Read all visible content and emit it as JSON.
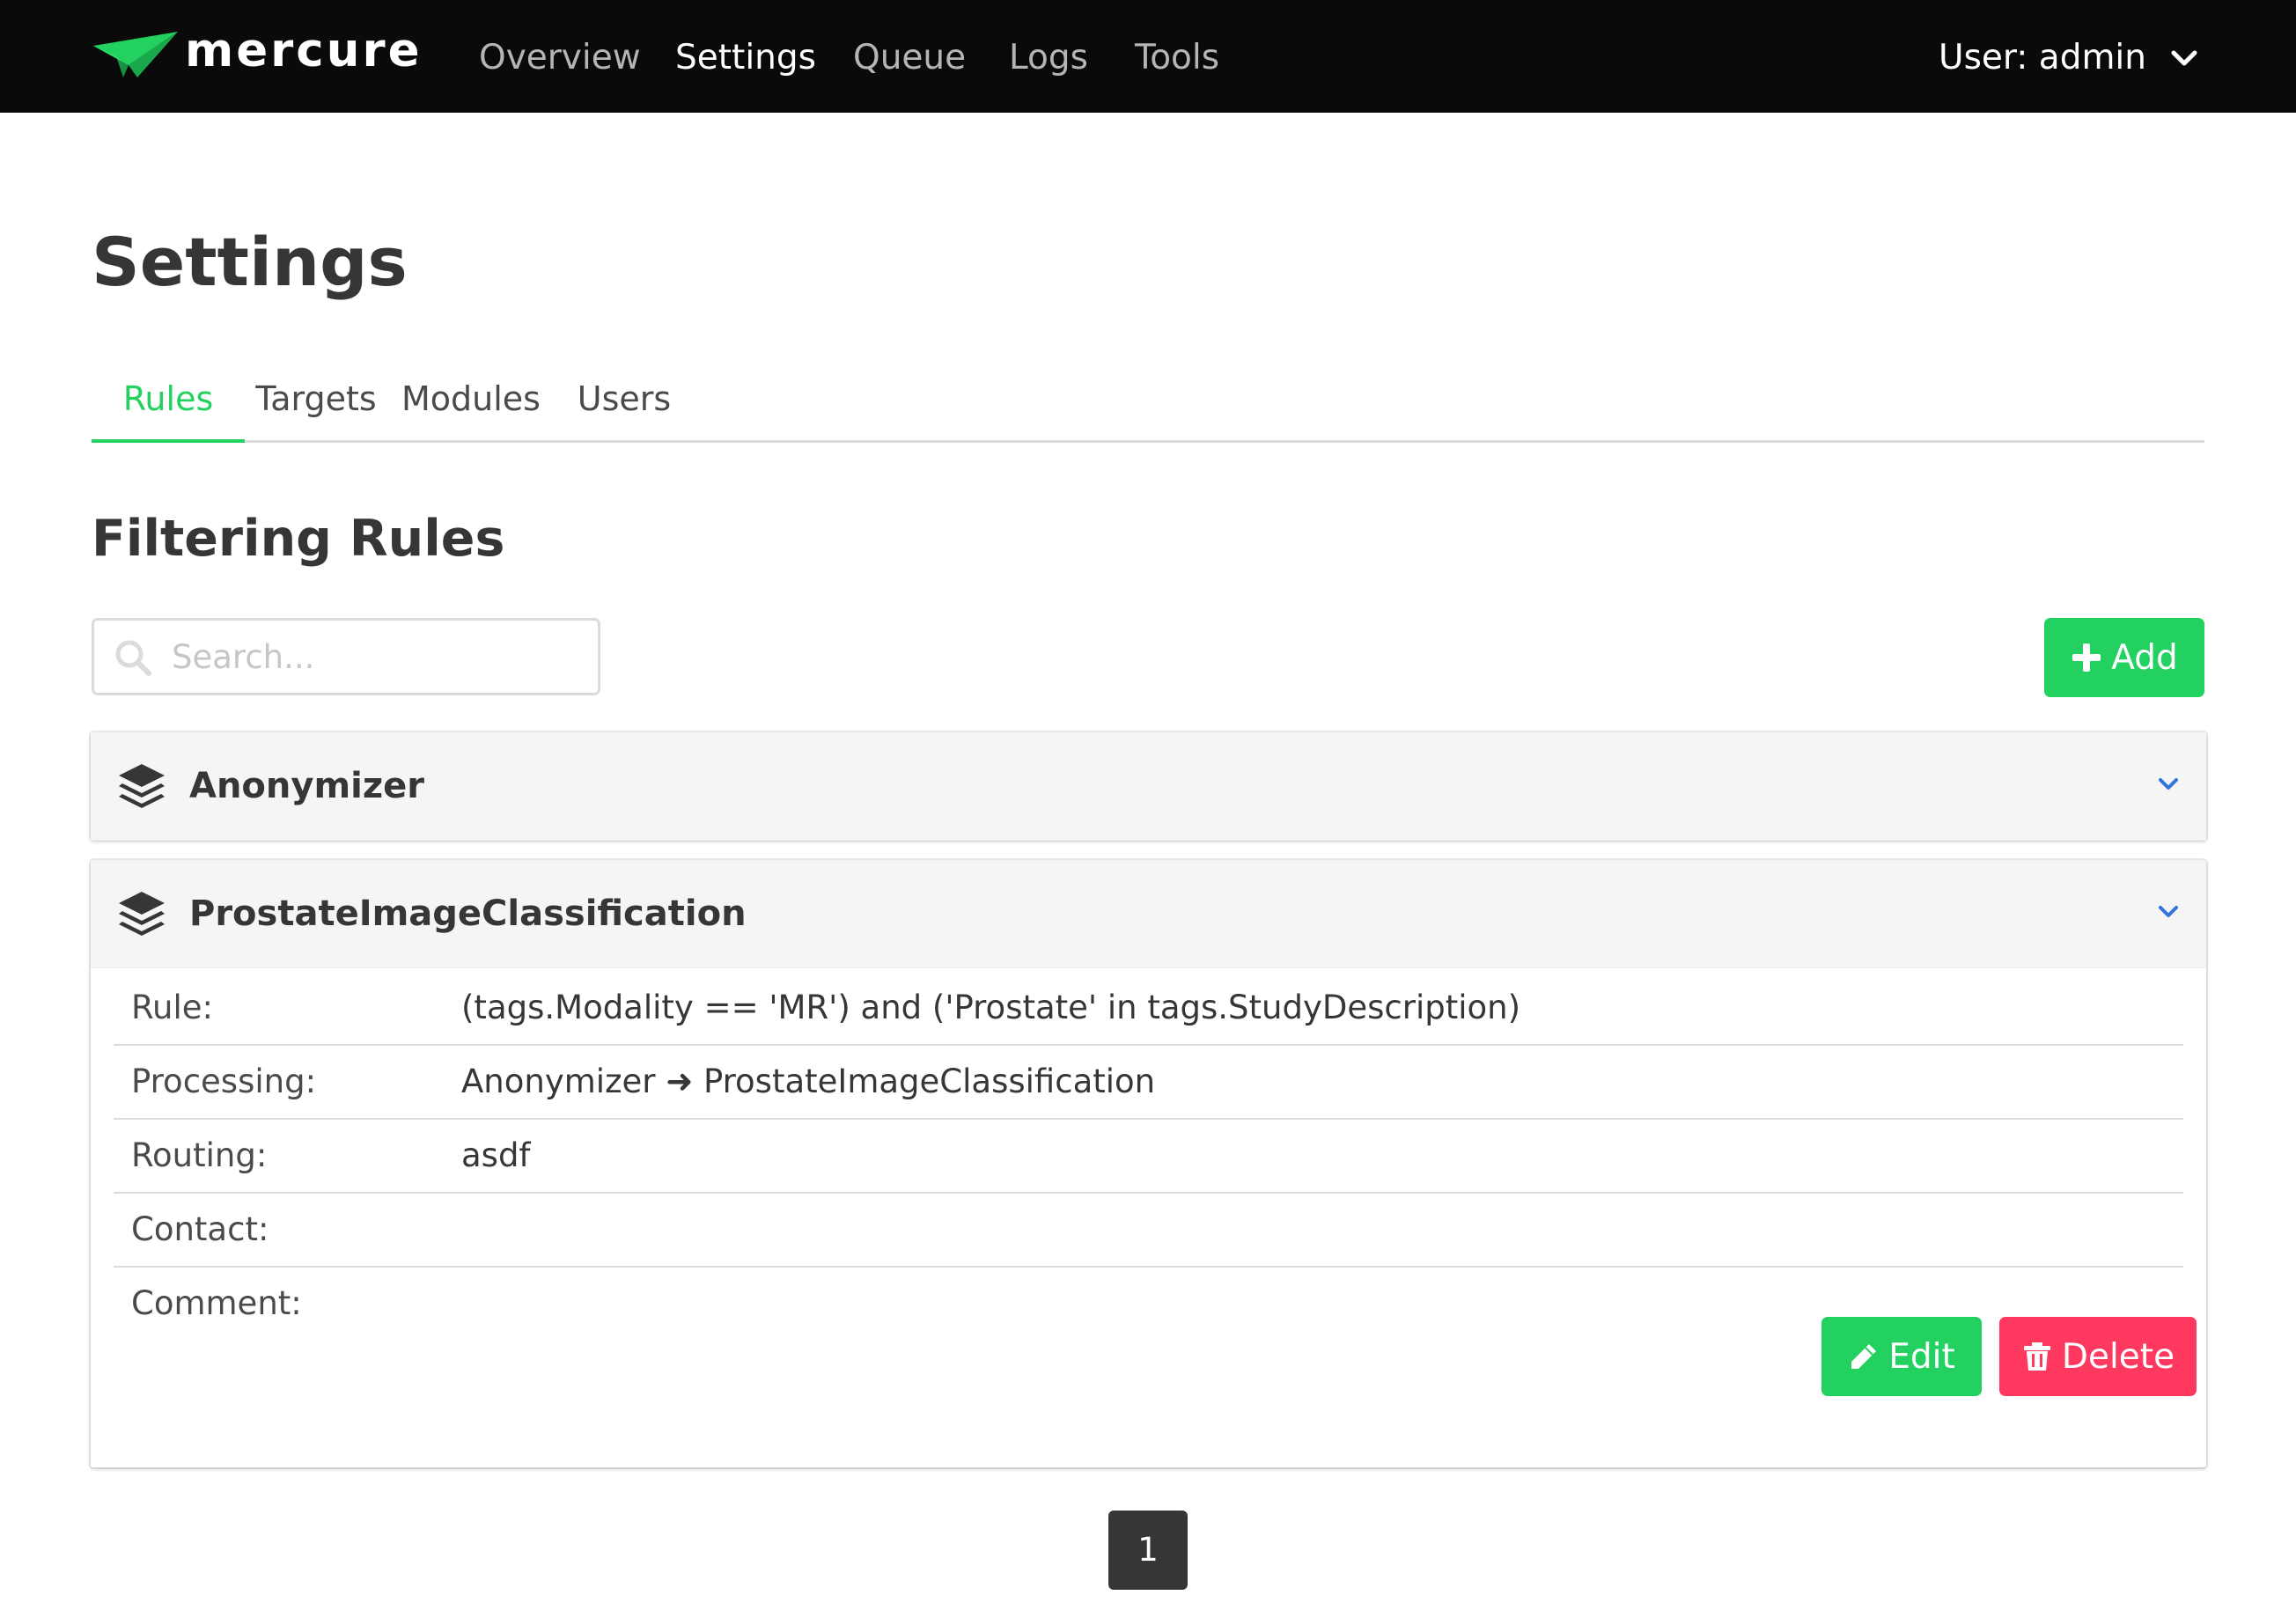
{
  "app": {
    "brand": "mercure",
    "accent_color": "#23d160",
    "danger_color": "#ff3860",
    "navbar_color": "#0a0a0a"
  },
  "nav": {
    "items": [
      {
        "label": "Overview",
        "active": false
      },
      {
        "label": "Settings",
        "active": true
      },
      {
        "label": "Queue",
        "active": false
      },
      {
        "label": "Logs",
        "active": false
      },
      {
        "label": "Tools",
        "active": false
      }
    ],
    "user_label": "User: admin",
    "user_icon": "chevron-down-icon"
  },
  "page": {
    "title": "Settings",
    "tabs": [
      {
        "label": "Rules",
        "active": true
      },
      {
        "label": "Targets",
        "active": false
      },
      {
        "label": "Modules",
        "active": false
      },
      {
        "label": "Users",
        "active": false
      }
    ],
    "section_title": "Filtering Rules"
  },
  "search": {
    "placeholder": "Search...",
    "value": "",
    "icon": "search-icon"
  },
  "toolbar": {
    "add_label": "Add",
    "add_icon": "plus-icon"
  },
  "rules": [
    {
      "name": "Anonymizer",
      "icon": "layers-icon",
      "expanded": false
    },
    {
      "name": "ProstateImageClassification",
      "icon": "layers-icon",
      "expanded": true,
      "details": {
        "rule_label": "Rule:",
        "rule_value": "(tags.Modality == 'MR') and ('Prostate' in tags.StudyDescription)",
        "processing_label": "Processing:",
        "processing_value": "Anonymizer ➜ ProstateImageClassification",
        "routing_label": "Routing:",
        "routing_value": "asdf",
        "contact_label": "Contact:",
        "contact_value": "",
        "comment_label": "Comment:",
        "comment_value": ""
      },
      "edit_label": "Edit",
      "edit_icon": "pencil-icon",
      "delete_label": "Delete",
      "delete_icon": "trash-icon"
    }
  ],
  "pagination": {
    "current_page": "1"
  }
}
